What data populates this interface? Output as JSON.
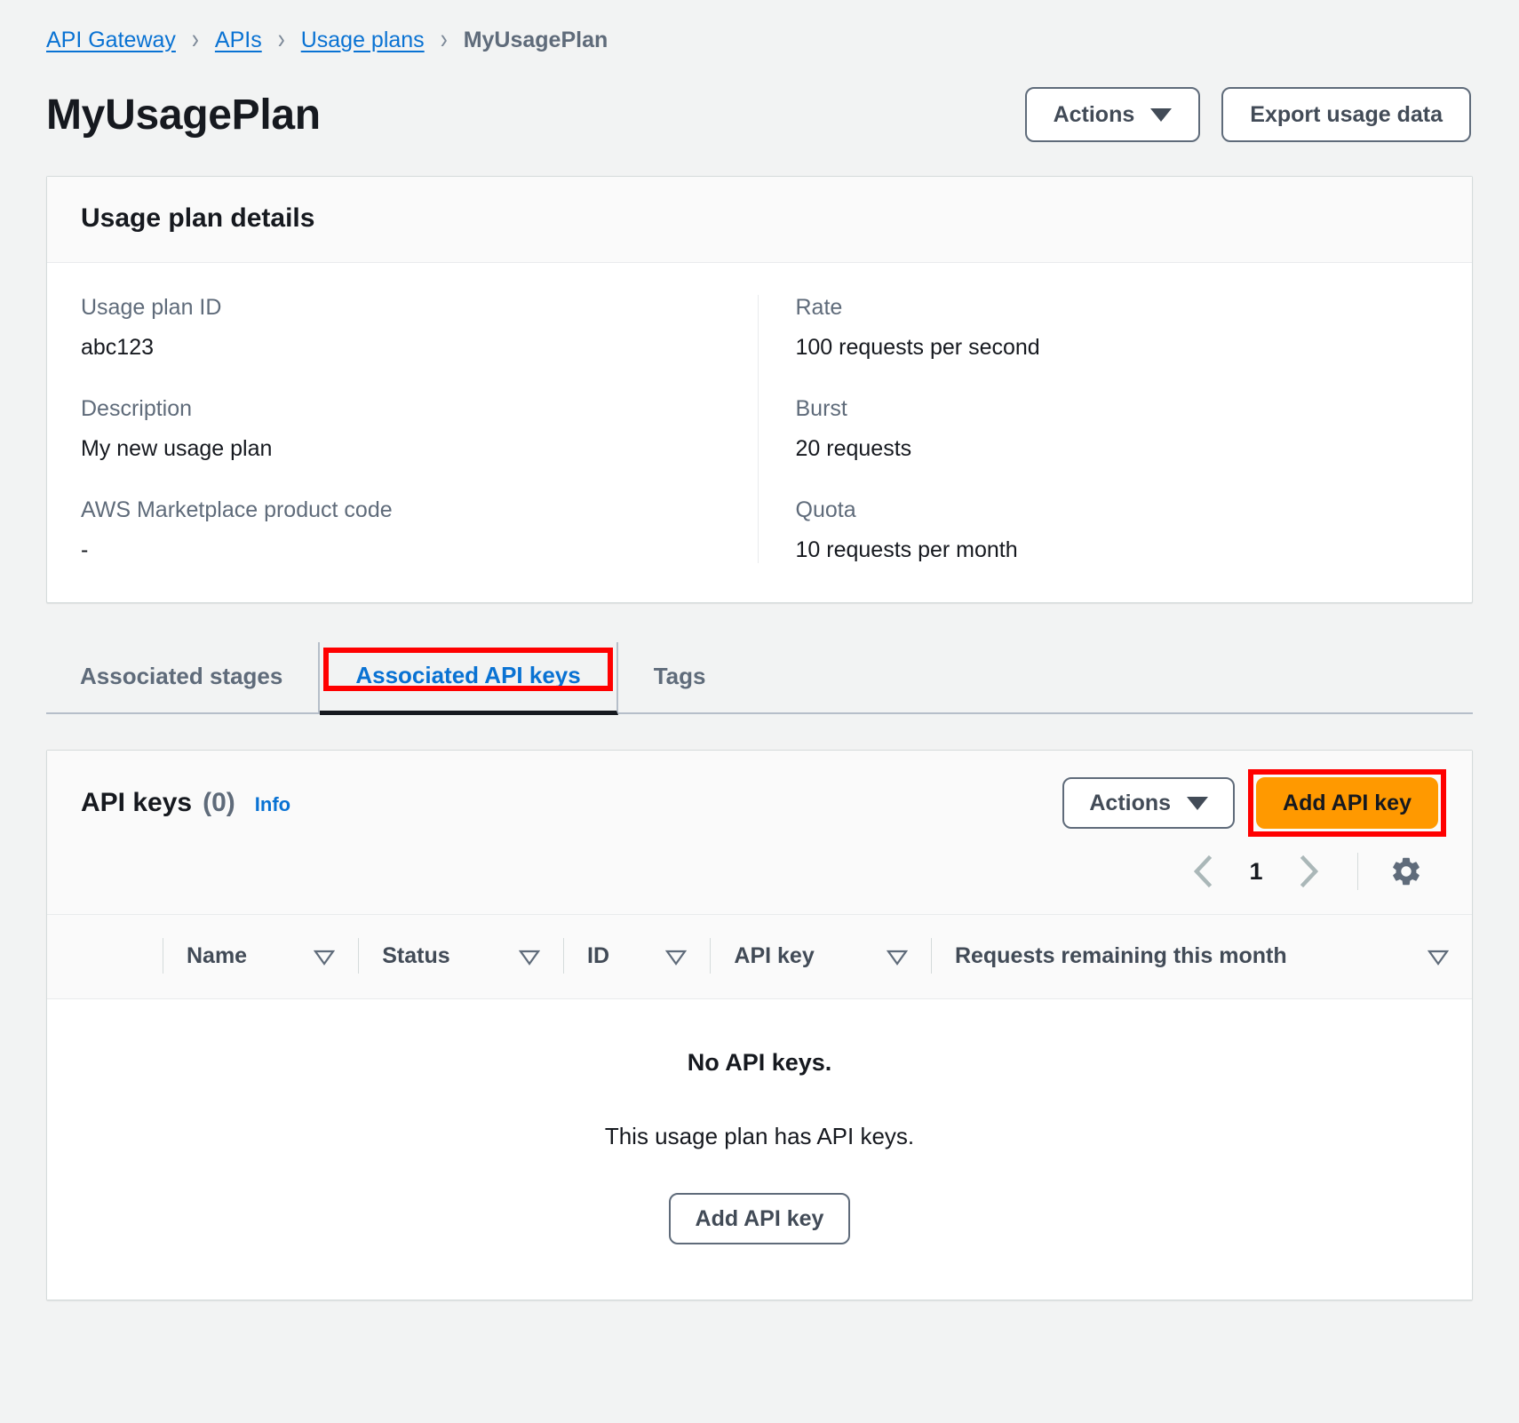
{
  "breadcrumb": {
    "items": [
      {
        "label": "API Gateway",
        "current": false
      },
      {
        "label": "APIs",
        "current": false
      },
      {
        "label": "Usage plans",
        "current": false
      },
      {
        "label": "MyUsagePlan",
        "current": true
      }
    ],
    "separator": "›"
  },
  "header": {
    "title": "MyUsagePlan",
    "actions_label": "Actions",
    "export_label": "Export usage data"
  },
  "details": {
    "panel_title": "Usage plan details",
    "left_fields": [
      {
        "label": "Usage plan ID",
        "value": "abc123"
      },
      {
        "label": "Description",
        "value": "My new usage plan"
      },
      {
        "label": "AWS Marketplace product code",
        "value": "-"
      }
    ],
    "right_fields": [
      {
        "label": "Rate",
        "value": "100 requests per second"
      },
      {
        "label": "Burst",
        "value": "20 requests"
      },
      {
        "label": "Quota",
        "value": "10 requests per month"
      }
    ]
  },
  "tabs": [
    {
      "label": "Associated stages",
      "active": false
    },
    {
      "label": "Associated API keys",
      "active": true
    },
    {
      "label": "Tags",
      "active": false
    }
  ],
  "api_keys": {
    "title": "API keys",
    "count": "(0)",
    "info_label": "Info",
    "actions_label": "Actions",
    "add_key_label": "Add API key",
    "pagination": {
      "page": "1"
    },
    "columns": [
      "Name",
      "Status",
      "ID",
      "API key",
      "Requests remaining this month"
    ],
    "empty_title": "No API keys.",
    "empty_subtitle": "This usage plan has API keys.",
    "empty_button_label": "Add API key"
  },
  "colors": {
    "link": "#0972d3",
    "primary": "#ff9900",
    "annotation": "#ff0000",
    "text": "#16191f",
    "muted": "#5f6b7a",
    "page_bg": "#f2f3f3"
  },
  "icons": {
    "caret_down": "chevron-down-icon",
    "sort": "sort-descending-icon",
    "prev": "chevron-left-icon",
    "next": "chevron-right-icon",
    "settings": "gear-icon"
  }
}
